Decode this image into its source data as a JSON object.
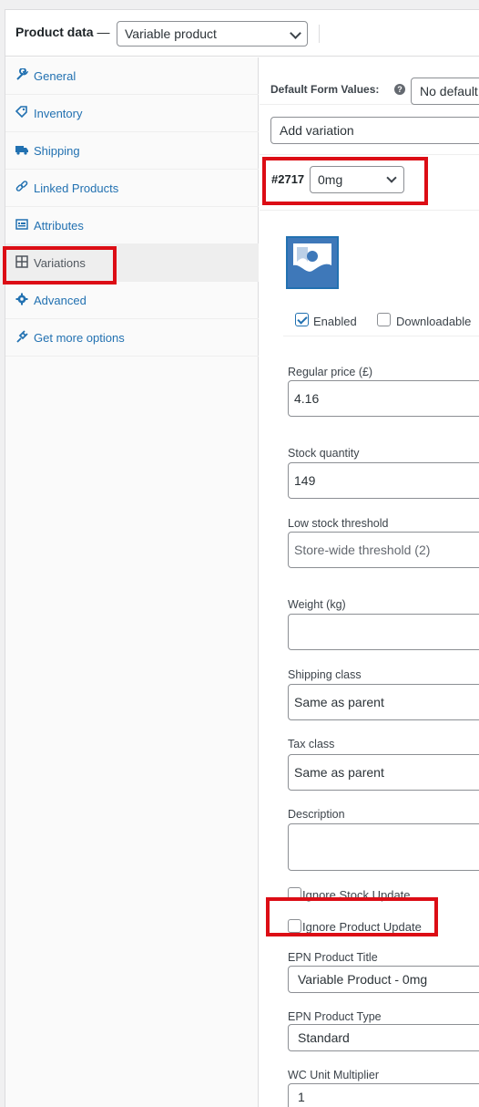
{
  "header": {
    "title": "Product data",
    "separator": "—",
    "product_type": "Variable product"
  },
  "sidebar": {
    "items": [
      {
        "label": "General",
        "icon": "wrench-icon"
      },
      {
        "label": "Inventory",
        "icon": "tag-icon"
      },
      {
        "label": "Shipping",
        "icon": "truck-icon"
      },
      {
        "label": "Linked Products",
        "icon": "link-icon"
      },
      {
        "label": "Attributes",
        "icon": "list-icon"
      },
      {
        "label": "Variations",
        "icon": "grid-icon"
      },
      {
        "label": "Advanced",
        "icon": "gear-icon"
      },
      {
        "label": "Get more options",
        "icon": "plugin-icon"
      }
    ],
    "active": "Variations"
  },
  "defaults": {
    "label": "Default Form Values:",
    "value": "No default"
  },
  "add_variation": {
    "value": "Add variation"
  },
  "variation": {
    "id": "#2717",
    "attribute_value": "0mg",
    "enabled_label": "Enabled",
    "enabled": true,
    "downloadable_label": "Downloadable",
    "downloadable": false,
    "regular_price_label": "Regular price (£)",
    "regular_price": "4.16",
    "stock_qty_label": "Stock quantity",
    "stock_qty": "149",
    "low_stock_label": "Low stock threshold",
    "low_stock_placeholder": "Store-wide threshold (2)",
    "weight_label": "Weight (kg)",
    "weight": "",
    "shipping_class_label": "Shipping class",
    "shipping_class": "Same as parent",
    "tax_class_label": "Tax class",
    "tax_class": "Same as parent",
    "description_label": "Description",
    "description": "",
    "ignore_stock_label": "Ignore Stock Update",
    "ignore_stock": false,
    "ignore_product_label": "Ignore Product Update",
    "ignore_product": false,
    "epn_title_label": "EPN Product Title",
    "epn_title": "Variable Product - 0mg",
    "epn_type_label": "EPN Product Type",
    "epn_type": "Standard",
    "wc_multiplier_label": "WC Unit Multiplier",
    "wc_multiplier": "1"
  },
  "colors": {
    "accent": "#2271b1",
    "highlight": "#dc0d15"
  }
}
